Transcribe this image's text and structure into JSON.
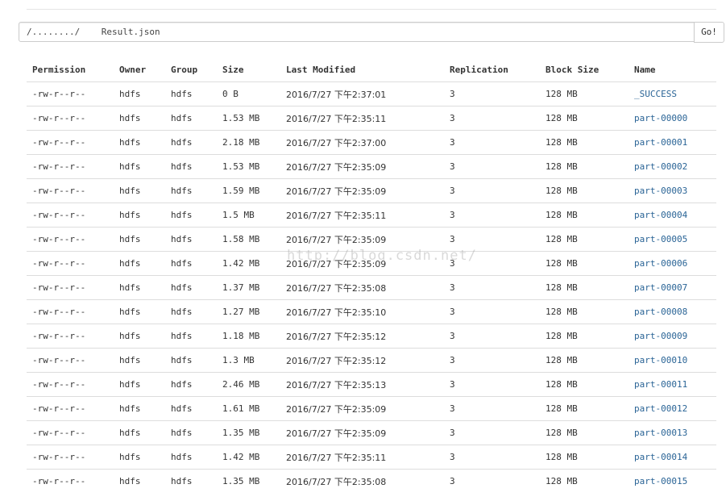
{
  "path": {
    "value": "/......../    Result.json",
    "go_label": "Go!"
  },
  "table": {
    "headers": {
      "permission": "Permission",
      "owner": "Owner",
      "group": "Group",
      "size": "Size",
      "last_modified": "Last Modified",
      "replication": "Replication",
      "block_size": "Block Size",
      "name": "Name"
    },
    "rows": [
      {
        "permission": "-rw-r--r--",
        "owner": "hdfs",
        "group": "hdfs",
        "size": "0 B",
        "last_modified": "2016/7/27 下午2:37:01",
        "replication": "3",
        "block_size": "128 MB",
        "name": "_SUCCESS"
      },
      {
        "permission": "-rw-r--r--",
        "owner": "hdfs",
        "group": "hdfs",
        "size": "1.53 MB",
        "last_modified": "2016/7/27 下午2:35:11",
        "replication": "3",
        "block_size": "128 MB",
        "name": "part-00000"
      },
      {
        "permission": "-rw-r--r--",
        "owner": "hdfs",
        "group": "hdfs",
        "size": "2.18 MB",
        "last_modified": "2016/7/27 下午2:37:00",
        "replication": "3",
        "block_size": "128 MB",
        "name": "part-00001"
      },
      {
        "permission": "-rw-r--r--",
        "owner": "hdfs",
        "group": "hdfs",
        "size": "1.53 MB",
        "last_modified": "2016/7/27 下午2:35:09",
        "replication": "3",
        "block_size": "128 MB",
        "name": "part-00002"
      },
      {
        "permission": "-rw-r--r--",
        "owner": "hdfs",
        "group": "hdfs",
        "size": "1.59 MB",
        "last_modified": "2016/7/27 下午2:35:09",
        "replication": "3",
        "block_size": "128 MB",
        "name": "part-00003"
      },
      {
        "permission": "-rw-r--r--",
        "owner": "hdfs",
        "group": "hdfs",
        "size": "1.5 MB",
        "last_modified": "2016/7/27 下午2:35:11",
        "replication": "3",
        "block_size": "128 MB",
        "name": "part-00004"
      },
      {
        "permission": "-rw-r--r--",
        "owner": "hdfs",
        "group": "hdfs",
        "size": "1.58 MB",
        "last_modified": "2016/7/27 下午2:35:09",
        "replication": "3",
        "block_size": "128 MB",
        "name": "part-00005"
      },
      {
        "permission": "-rw-r--r--",
        "owner": "hdfs",
        "group": "hdfs",
        "size": "1.42 MB",
        "last_modified": "2016/7/27 下午2:35:09",
        "replication": "3",
        "block_size": "128 MB",
        "name": "part-00006"
      },
      {
        "permission": "-rw-r--r--",
        "owner": "hdfs",
        "group": "hdfs",
        "size": "1.37 MB",
        "last_modified": "2016/7/27 下午2:35:08",
        "replication": "3",
        "block_size": "128 MB",
        "name": "part-00007"
      },
      {
        "permission": "-rw-r--r--",
        "owner": "hdfs",
        "group": "hdfs",
        "size": "1.27 MB",
        "last_modified": "2016/7/27 下午2:35:10",
        "replication": "3",
        "block_size": "128 MB",
        "name": "part-00008"
      },
      {
        "permission": "-rw-r--r--",
        "owner": "hdfs",
        "group": "hdfs",
        "size": "1.18 MB",
        "last_modified": "2016/7/27 下午2:35:12",
        "replication": "3",
        "block_size": "128 MB",
        "name": "part-00009"
      },
      {
        "permission": "-rw-r--r--",
        "owner": "hdfs",
        "group": "hdfs",
        "size": "1.3 MB",
        "last_modified": "2016/7/27 下午2:35:12",
        "replication": "3",
        "block_size": "128 MB",
        "name": "part-00010"
      },
      {
        "permission": "-rw-r--r--",
        "owner": "hdfs",
        "group": "hdfs",
        "size": "2.46 MB",
        "last_modified": "2016/7/27 下午2:35:13",
        "replication": "3",
        "block_size": "128 MB",
        "name": "part-00011"
      },
      {
        "permission": "-rw-r--r--",
        "owner": "hdfs",
        "group": "hdfs",
        "size": "1.61 MB",
        "last_modified": "2016/7/27 下午2:35:09",
        "replication": "3",
        "block_size": "128 MB",
        "name": "part-00012"
      },
      {
        "permission": "-rw-r--r--",
        "owner": "hdfs",
        "group": "hdfs",
        "size": "1.35 MB",
        "last_modified": "2016/7/27 下午2:35:09",
        "replication": "3",
        "block_size": "128 MB",
        "name": "part-00013"
      },
      {
        "permission": "-rw-r--r--",
        "owner": "hdfs",
        "group": "hdfs",
        "size": "1.42 MB",
        "last_modified": "2016/7/27 下午2:35:11",
        "replication": "3",
        "block_size": "128 MB",
        "name": "part-00014"
      },
      {
        "permission": "-rw-r--r--",
        "owner": "hdfs",
        "group": "hdfs",
        "size": "1.35 MB",
        "last_modified": "2016/7/27 下午2:35:08",
        "replication": "3",
        "block_size": "128 MB",
        "name": "part-00015"
      }
    ]
  },
  "watermark": "http://blog.csdn.net/",
  "colors": {
    "link": "#2a6496",
    "text": "#333333",
    "border": "#dddddd"
  }
}
